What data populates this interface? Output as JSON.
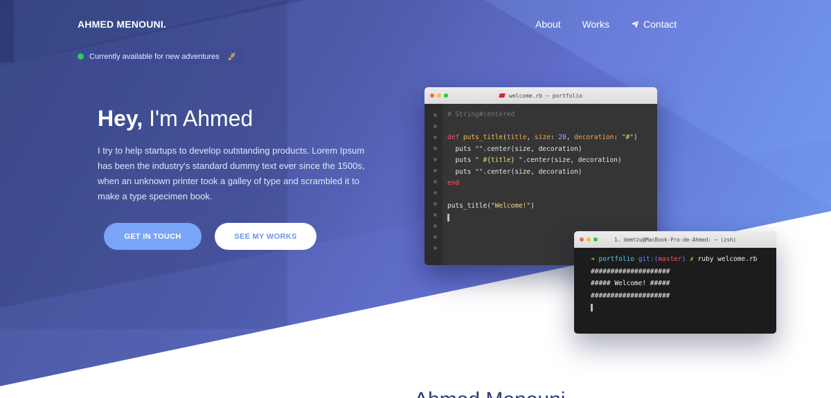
{
  "brand": {
    "name": "AHMED MENOUNI."
  },
  "nav": {
    "about": "About",
    "works": "Works",
    "contact": "Contact"
  },
  "status": {
    "text": "Currently available for new adventures",
    "emoji": "🚀"
  },
  "hero": {
    "greeting_bold": "Hey,",
    "greeting_rest": "I'm Ahmed",
    "intro": "I try to help startups to develop outstanding products. Lorem Ipsum has been the industry's standard dummy text ever since the 1500s, when an unknown printer took a galley of type and scrambled it to make a type specimen book.",
    "cta_primary": "GET IN TOUCH",
    "cta_secondary": "SEE MY WORKS"
  },
  "editor": {
    "title": "welcome.rb — portfolio",
    "lines": {
      "comment": "# String#centered",
      "def_kw": "def",
      "def_name": "puts_title",
      "def_args_1": "(",
      "def_arg_title": "title",
      "def_args_2": ", ",
      "def_arg_size": "size",
      "def_args_3": ": ",
      "def_num": "20",
      "def_args_4": ", ",
      "def_arg_dec": "decoration",
      "def_args_5": ": ",
      "def_str": "\"#\"",
      "def_args_6": ")",
      "l1_a": "  puts ",
      "l1_str": "\"\"",
      "l1_b": ".center(size, decoration)",
      "l2_a": "  puts ",
      "l2_str": "\" #{title} \"",
      "l2_b": ".center(size, decoration)",
      "l3_a": "  puts ",
      "l3_str": "\"\"",
      "l3_b": ".center(size, decoration)",
      "end_kw": "end",
      "call_a": "puts_title(",
      "call_str": "\"Welcome!\"",
      "call_b": ")"
    }
  },
  "terminal": {
    "title": "1. demtzu@MacBook-Pro-de-Ahmed: ~ (zsh)",
    "prompt_arrow": "➜",
    "prompt_dir": "portfolio",
    "prompt_git": "git:(",
    "prompt_branch": "master",
    "prompt_git_close": ")",
    "prompt_x": "✗",
    "command": "ruby welcome.rb",
    "output_1": "####################",
    "output_2": "##### Welcome! #####",
    "output_3": "####################"
  },
  "footer": {
    "name": "Ahmed Menouni"
  }
}
